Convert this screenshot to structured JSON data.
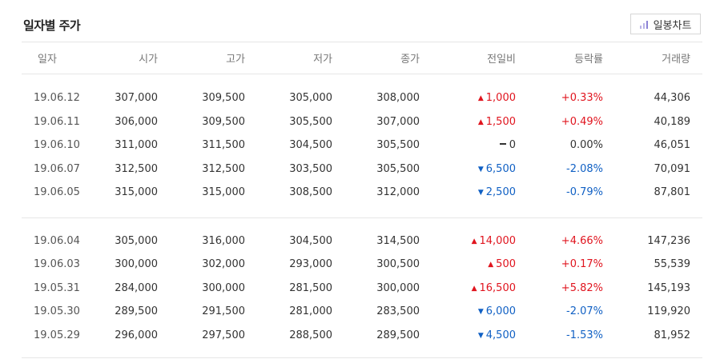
{
  "title": "일자별 주가",
  "chart_button": {
    "label": "일봉차트",
    "icon": "bar-chart-icon"
  },
  "headers": [
    "일자",
    "시가",
    "고가",
    "저가",
    "종가",
    "전일비",
    "등락률",
    "거래량"
  ],
  "colors": {
    "up": "#e0141e",
    "down": "#1060c4"
  },
  "groups": [
    {
      "rows": [
        {
          "date": "19.06.12",
          "open": "307,000",
          "high": "309,500",
          "low": "305,000",
          "close": "308,000",
          "dir": "up",
          "change": "1,000",
          "rate": "+0.33%",
          "volume": "44,306"
        },
        {
          "date": "19.06.11",
          "open": "306,000",
          "high": "309,500",
          "low": "305,500",
          "close": "307,000",
          "dir": "up",
          "change": "1,500",
          "rate": "+0.49%",
          "volume": "40,189"
        },
        {
          "date": "19.06.10",
          "open": "311,000",
          "high": "311,500",
          "low": "304,500",
          "close": "305,500",
          "dir": "flat",
          "change": "0",
          "rate": "0.00%",
          "volume": "46,051"
        },
        {
          "date": "19.06.07",
          "open": "312,500",
          "high": "312,500",
          "low": "303,500",
          "close": "305,500",
          "dir": "down",
          "change": "6,500",
          "rate": "-2.08%",
          "volume": "70,091"
        },
        {
          "date": "19.06.05",
          "open": "315,000",
          "high": "315,000",
          "low": "308,500",
          "close": "312,000",
          "dir": "down",
          "change": "2,500",
          "rate": "-0.79%",
          "volume": "87,801"
        }
      ]
    },
    {
      "rows": [
        {
          "date": "19.06.04",
          "open": "305,000",
          "high": "316,000",
          "low": "304,500",
          "close": "314,500",
          "dir": "up",
          "change": "14,000",
          "rate": "+4.66%",
          "volume": "147,236"
        },
        {
          "date": "19.06.03",
          "open": "300,000",
          "high": "302,000",
          "low": "293,000",
          "close": "300,500",
          "dir": "up",
          "change": "500",
          "rate": "+0.17%",
          "volume": "55,539"
        },
        {
          "date": "19.05.31",
          "open": "284,000",
          "high": "300,000",
          "low": "281,500",
          "close": "300,000",
          "dir": "up",
          "change": "16,500",
          "rate": "+5.82%",
          "volume": "145,193"
        },
        {
          "date": "19.05.30",
          "open": "289,500",
          "high": "291,500",
          "low": "281,000",
          "close": "283,500",
          "dir": "down",
          "change": "6,000",
          "rate": "-2.07%",
          "volume": "119,920"
        },
        {
          "date": "19.05.29",
          "open": "296,000",
          "high": "297,500",
          "low": "288,500",
          "close": "289,500",
          "dir": "down",
          "change": "4,500",
          "rate": "-1.53%",
          "volume": "81,952"
        }
      ]
    }
  ]
}
